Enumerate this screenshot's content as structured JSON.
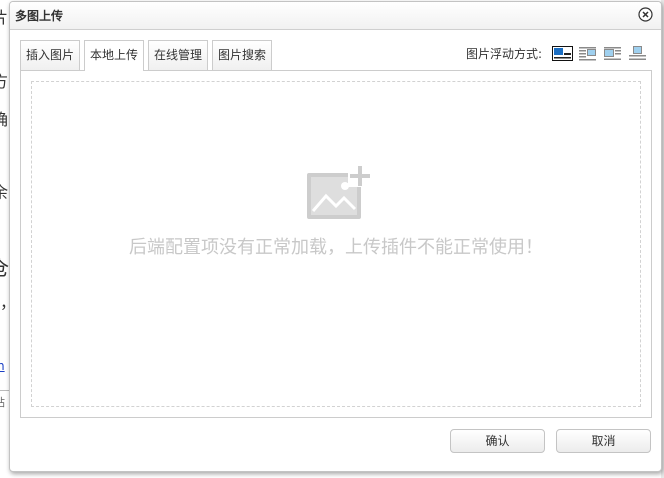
{
  "background": {
    "fragments": [
      {
        "text": "片"
      },
      {
        "text": "方"
      },
      {
        "text": "确"
      },
      {
        "text": "余"
      },
      {
        "text": "仓"
      },
      {
        "text": "，"
      },
      {
        "text": "n"
      },
      {
        "text": "钻"
      }
    ]
  },
  "dialog": {
    "title": "多图上传",
    "close_icon": "close-icon"
  },
  "tabs": [
    {
      "label": "插入图片",
      "active": false
    },
    {
      "label": "本地上传",
      "active": true
    },
    {
      "label": "在线管理",
      "active": false
    },
    {
      "label": "图片搜索",
      "active": false
    }
  ],
  "float_align": {
    "label": "图片浮动方式:",
    "options": [
      {
        "icon": "float-none-icon",
        "selected": true
      },
      {
        "icon": "float-left-icon",
        "selected": false
      },
      {
        "icon": "float-right-icon",
        "selected": false
      },
      {
        "icon": "float-center-icon",
        "selected": false
      }
    ]
  },
  "upload": {
    "placeholder_icon": "image-add-icon",
    "message": "后端配置项没有正常加载，上传插件不能正常使用！"
  },
  "buttons": {
    "ok": "确认",
    "cancel": "取消"
  },
  "colors": {
    "border": "#cccccc",
    "message_text": "#c8c8c8",
    "float_selected": "#1b6ec2",
    "float_option": "#9fd0ef"
  }
}
